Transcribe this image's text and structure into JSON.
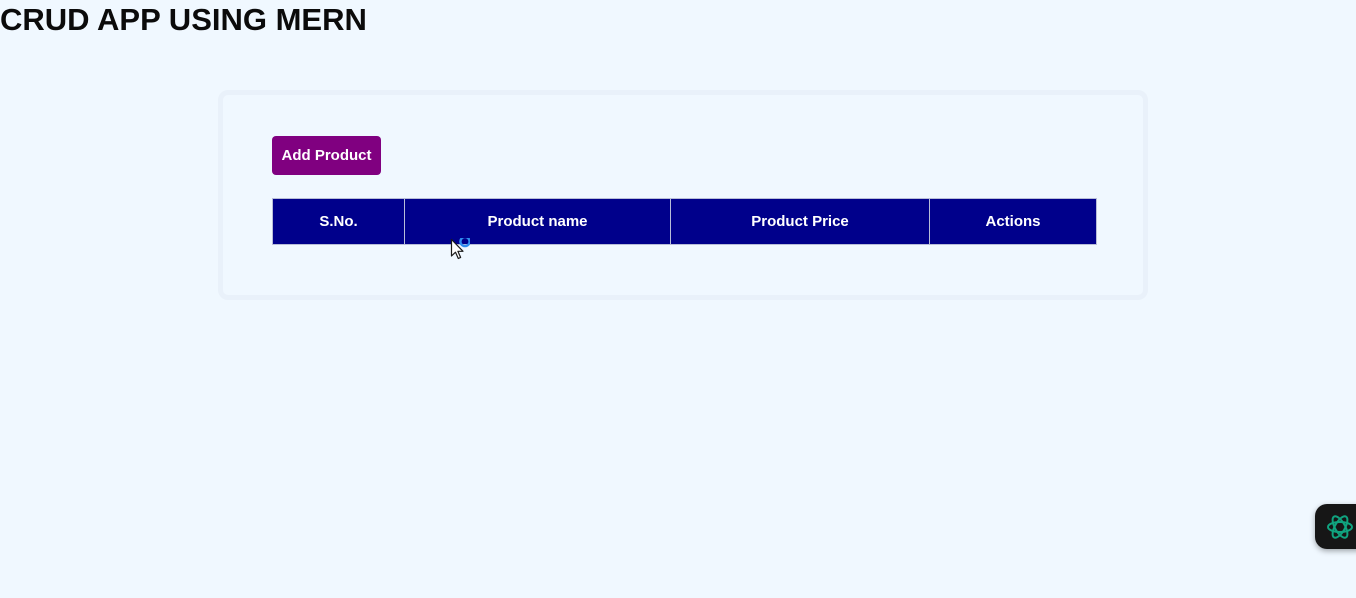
{
  "header": {
    "title": "CRUD APP USING MERN"
  },
  "toolbar": {
    "add_label": "Add Product"
  },
  "table": {
    "columns": [
      "S.No.",
      "Product name",
      "Product Price",
      "Actions"
    ],
    "rows": []
  },
  "colors": {
    "background": "#f0f8ff",
    "button": "#800080",
    "table_header": "#00008b",
    "fab_icon": "#10a37f"
  },
  "icons": {
    "floating": "openai-icon",
    "cursor": "mouse-cursor-icon"
  }
}
